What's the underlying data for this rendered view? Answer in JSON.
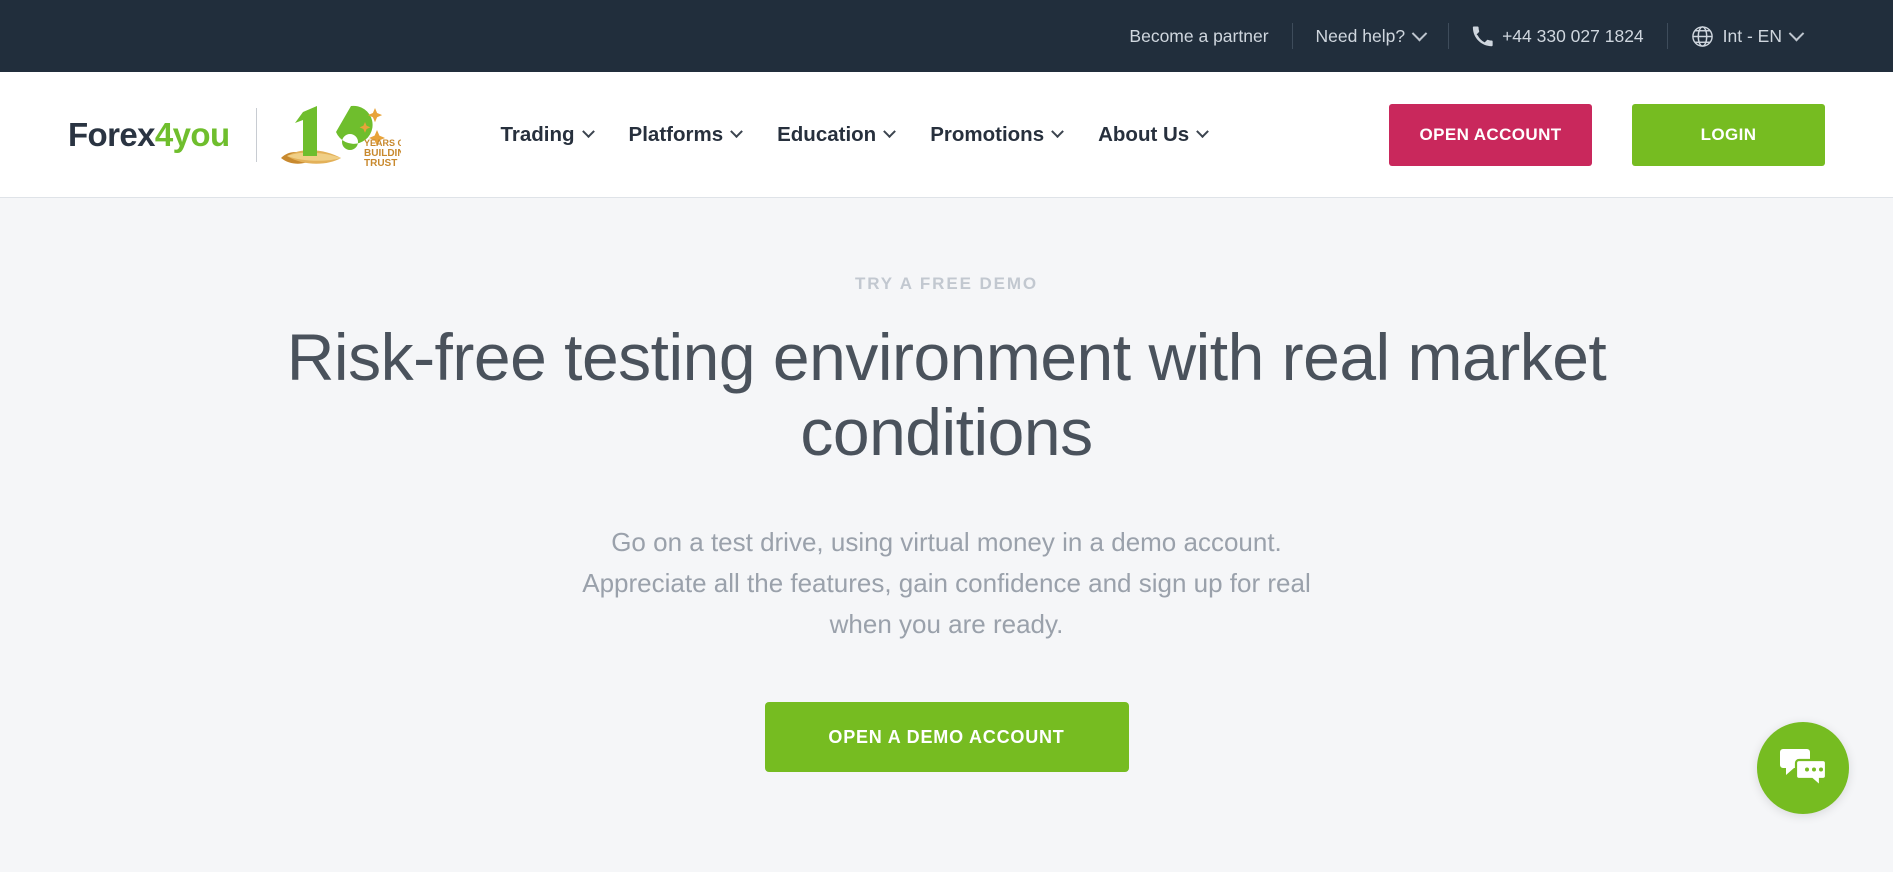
{
  "topbar": {
    "partner_label": "Become a partner",
    "need_help_label": "Need help?",
    "phone": "+44 330 027 1824",
    "language": "Int - EN",
    "icons": {
      "phone": "phone-icon",
      "globe": "globe-icon",
      "chevron": "chevron-down-icon"
    }
  },
  "brand": {
    "name_part1": "Forex",
    "name_part2": "4you",
    "anniversary_number": "16",
    "anniversary_line1": "YEARS OF",
    "anniversary_line2": "BUILDING",
    "anniversary_line3": "TRUST"
  },
  "nav": {
    "items": [
      {
        "label": "Trading"
      },
      {
        "label": "Platforms"
      },
      {
        "label": "Education"
      },
      {
        "label": "Promotions"
      },
      {
        "label": "About Us"
      }
    ],
    "open_account_label": "OPEN ACCOUNT",
    "login_label": "LOGIN"
  },
  "hero": {
    "eyebrow": "TRY A FREE DEMO",
    "title": "Risk-free testing environment with real market conditions",
    "subtitle": "Go on a test drive, using virtual money in a demo account. Appreciate all the features, gain confidence and sign up for real when you are ready.",
    "cta_label": "OPEN A DEMO ACCOUNT"
  },
  "chat": {
    "icon": "chat-bubbles-icon"
  },
  "colors": {
    "topbar_bg": "#212e3c",
    "brand_green": "#76bc21",
    "logo_green": "#6fbe2d",
    "crimson": "#c9285c",
    "hero_bg": "#f5f6f8",
    "heading": "#4a525c",
    "muted": "#9aa1ab",
    "eyebrow": "#c2c8d0",
    "gold": "#d9a441"
  }
}
